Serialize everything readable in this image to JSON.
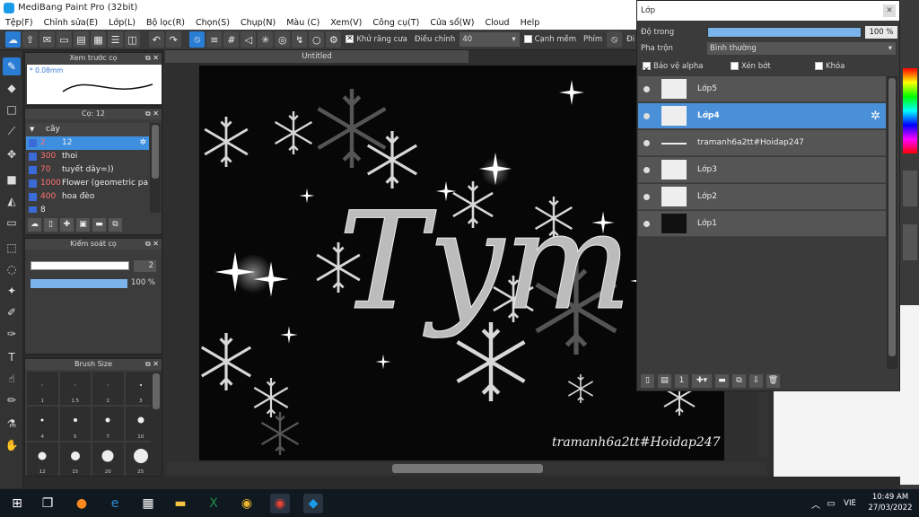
{
  "app": {
    "title": "MediBang Paint Pro (32bit)",
    "menu": [
      "Tệp(F)",
      "Chỉnh sửa(E)",
      "Lớp(L)",
      "Bộ lọc(R)",
      "Chọn(S)",
      "Chụp(N)",
      "Màu (C)",
      "Xem(V)",
      "Công cụ(T)",
      "Cửa sổ(W)",
      "Cloud",
      "Help"
    ]
  },
  "toolbar": {
    "antialias_label": "Khử răng cưa",
    "stabilizer_label": "Điều chỉnh",
    "stabilizer_value": "40",
    "edge_label": "Cạnh mềm",
    "key_label": "Phím",
    "key2_label": "Đi"
  },
  "brush_preview": {
    "title": "Xem trước cọ",
    "size": "* 0.08mm"
  },
  "brush_panel": {
    "title": "Cọ: 12",
    "group": "cây",
    "items": [
      {
        "size": "2",
        "name": "12",
        "selected": true
      },
      {
        "size": "300",
        "name": "thoi"
      },
      {
        "size": "70",
        "name": "tuyết dây=))"
      },
      {
        "size": "1000",
        "name": "Flower (geometric patt"
      },
      {
        "size": "400",
        "name": "hoa đèo"
      },
      {
        "size": "8",
        "name": ""
      }
    ]
  },
  "brush_control": {
    "title": "Kiểm soát cọ",
    "size_value": "2",
    "opacity_value": "100 %"
  },
  "brush_size": {
    "title": "Brush Size",
    "labels": [
      "1",
      "1.5",
      "2",
      "3",
      "4",
      "5",
      "7",
      "10",
      "12",
      "15",
      "20",
      "25"
    ],
    "dot_sizes": [
      1,
      1,
      1,
      2,
      3,
      4,
      5,
      7,
      9,
      10,
      13,
      16
    ]
  },
  "canvas": {
    "tab_title": "Untitled",
    "watermark": "tramanh6a2tt#Hoidap247",
    "art_text": "Tym"
  },
  "layers_window": {
    "title": "Lớp",
    "opacity_label": "Độ trong",
    "opacity_value": "100 %",
    "blend_label": "Pha trộn",
    "blend_value": "Bình thường",
    "protect_alpha": "Bảo vệ alpha",
    "clipping": "Xén bớt",
    "lock": "Khóa",
    "layers": [
      {
        "name": "Lớp5",
        "thumb": "light"
      },
      {
        "name": "Lớp4",
        "thumb": "light",
        "selected": true
      },
      {
        "name": "tramanh6a2tt#Hoidap247",
        "thumb": "line"
      },
      {
        "name": "Lớp3",
        "thumb": "light"
      },
      {
        "name": "Lớp2",
        "thumb": "light"
      },
      {
        "name": "Lớp1",
        "thumb": "dark"
      }
    ]
  },
  "taskbar": {
    "lang": "VIE",
    "time": "10:49 AM",
    "date": "27/03/2022"
  }
}
